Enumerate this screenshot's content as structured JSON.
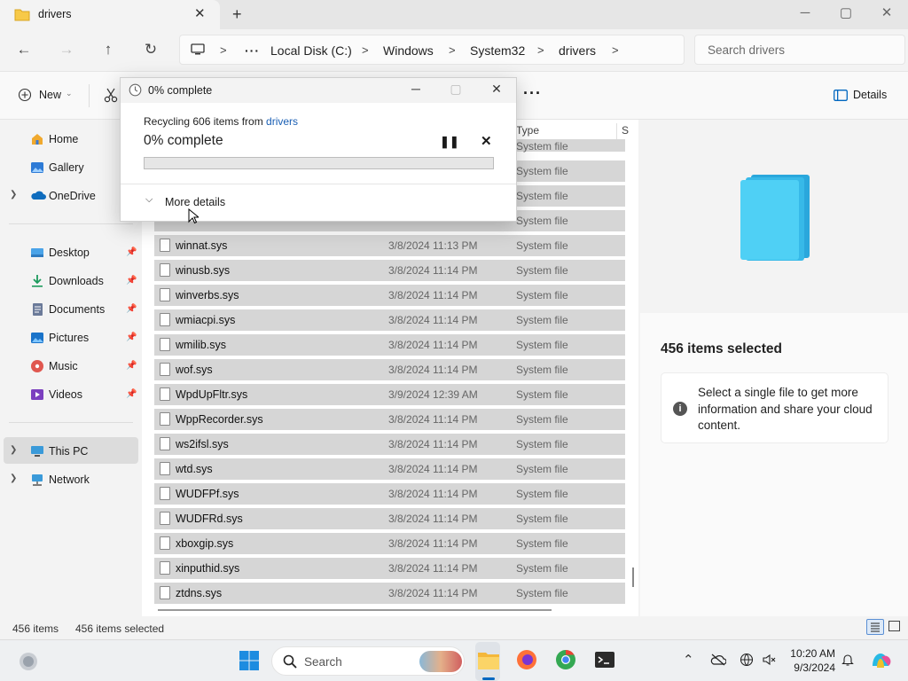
{
  "window": {
    "tab_title": "drivers",
    "tab_close": "✕",
    "new_tab": "+",
    "minimize": "─",
    "maximize": "▢",
    "close": "✕"
  },
  "nav": {
    "back": "←",
    "forward": "→",
    "up": "↑",
    "refresh": "↻",
    "overflow": "···",
    "breadcrumbs": [
      "Local Disk (C:)",
      "Windows",
      "System32",
      "drivers"
    ],
    "separator": ">",
    "search_placeholder": "Search drivers"
  },
  "toolbar": {
    "new_label": "New",
    "more": "···",
    "details_label": "Details"
  },
  "sidebar": {
    "items": [
      {
        "label": "Home",
        "icon": "home-icon"
      },
      {
        "label": "Gallery",
        "icon": "gallery-icon"
      },
      {
        "label": "OneDrive",
        "icon": "onedrive-icon",
        "expandable": true
      },
      {
        "label": "Desktop",
        "icon": "desktop-icon",
        "pinned": true
      },
      {
        "label": "Downloads",
        "icon": "downloads-icon",
        "pinned": true
      },
      {
        "label": "Documents",
        "icon": "documents-icon",
        "pinned": true
      },
      {
        "label": "Pictures",
        "icon": "pictures-icon",
        "pinned": true
      },
      {
        "label": "Music",
        "icon": "music-icon",
        "pinned": true
      },
      {
        "label": "Videos",
        "icon": "videos-icon",
        "pinned": true
      },
      {
        "label": "This PC",
        "icon": "this-pc-icon",
        "expandable": true,
        "selected": true
      },
      {
        "label": "Network",
        "icon": "network-icon",
        "expandable": true
      }
    ]
  },
  "filelist": {
    "header_type": "Type",
    "rows": [
      {
        "name": "winnat.sys",
        "date": "3/8/2024 11:13 PM",
        "type": "System file"
      },
      {
        "name": "winusb.sys",
        "date": "3/8/2024 11:14 PM",
        "type": "System file"
      },
      {
        "name": "winverbs.sys",
        "date": "3/8/2024 11:14 PM",
        "type": "System file"
      },
      {
        "name": "wmiacpi.sys",
        "date": "3/8/2024 11:14 PM",
        "type": "System file"
      },
      {
        "name": "wmilib.sys",
        "date": "3/8/2024 11:14 PM",
        "type": "System file"
      },
      {
        "name": "wof.sys",
        "date": "3/8/2024 11:14 PM",
        "type": "System file"
      },
      {
        "name": "WpdUpFltr.sys",
        "date": "3/9/2024 12:39 AM",
        "type": "System file"
      },
      {
        "name": "WppRecorder.sys",
        "date": "3/8/2024 11:14 PM",
        "type": "System file"
      },
      {
        "name": "ws2ifsl.sys",
        "date": "3/8/2024 11:14 PM",
        "type": "System file"
      },
      {
        "name": "wtd.sys",
        "date": "3/8/2024 11:14 PM",
        "type": "System file"
      },
      {
        "name": "WUDFPf.sys",
        "date": "3/8/2024 11:14 PM",
        "type": "System file"
      },
      {
        "name": "WUDFRd.sys",
        "date": "3/8/2024 11:14 PM",
        "type": "System file"
      },
      {
        "name": "xboxgip.sys",
        "date": "3/8/2024 11:14 PM",
        "type": "System file"
      },
      {
        "name": "xinputhid.sys",
        "date": "3/8/2024 11:14 PM",
        "type": "System file"
      },
      {
        "name": "ztdns.sys",
        "date": "3/8/2024 11:14 PM",
        "type": "System file"
      }
    ],
    "hidden_rows_type": "System file"
  },
  "details_pane": {
    "selected_count": "456 items selected",
    "info_text": "Select a single file to get more information and share your cloud content."
  },
  "statusbar": {
    "item_count": "456 items",
    "selected_count": "456 items selected"
  },
  "dialog": {
    "title": "0% complete",
    "message_prefix": "Recycling 606 items from ",
    "message_link": "drivers",
    "percent_label": "0% complete",
    "progress": 0,
    "pause": "❚❚",
    "cancel": "✕",
    "minimize": "─",
    "maximize": "▢",
    "close": "✕",
    "more_details": "More details"
  },
  "taskbar": {
    "search_label": "Search",
    "time": "10:20 AM",
    "date": "9/3/2024",
    "apps": [
      "start-icon",
      "file-explorer-icon",
      "firefox-icon",
      "chrome-icon",
      "terminal-icon",
      "copilot-icon"
    ]
  },
  "colors": {
    "selection_row": "#d6d6d6",
    "accent": "#0067c0",
    "link": "#1a5fb4"
  }
}
